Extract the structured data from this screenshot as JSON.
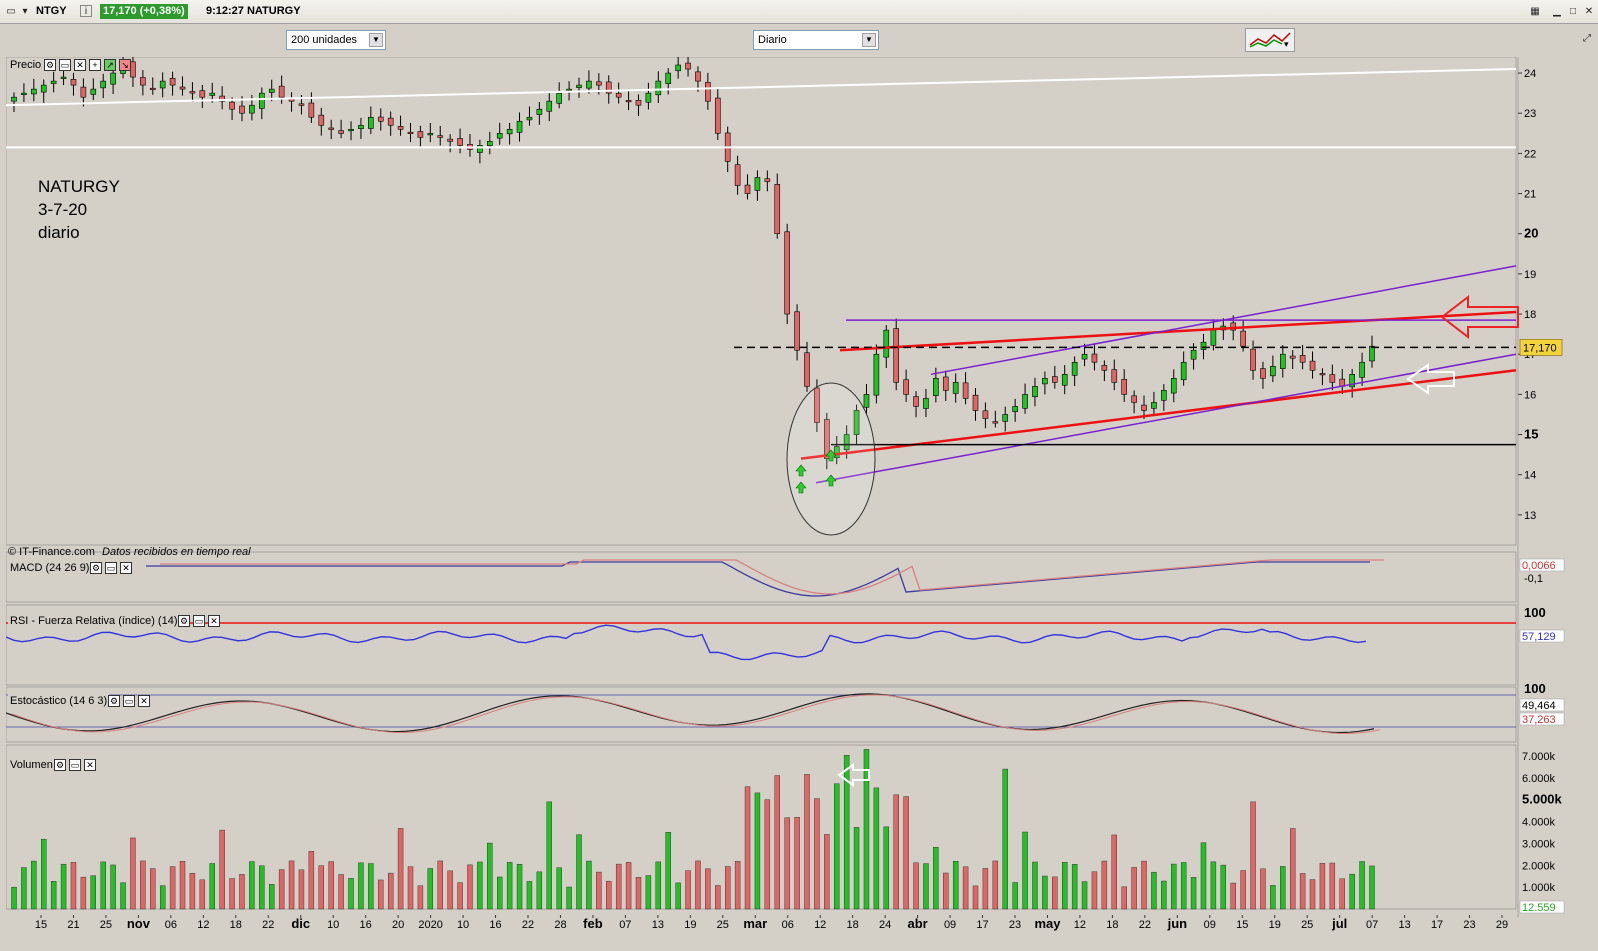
{
  "titlebar": {
    "ticker": "NTGY",
    "price_change": "17,170 (+0,38%)",
    "time_name": "9:12:27 NATURGY"
  },
  "toolbar": {
    "units_select": "200 unidades",
    "interval_select": "Diario"
  },
  "annotation": {
    "line1": "NATURGY",
    "line2": "3-7-20",
    "line3": "diario"
  },
  "copyright": "© IT-Finance.com",
  "realtime_note": "Datos recibidos en tiempo real",
  "panels": {
    "price_label": "Precio",
    "macd_label": "MACD (24 26 9)",
    "rsi_label": "RSI - Fuerza Relativa (índice) (14)",
    "stoch_label": "Estocástico (14 6 3)",
    "volume_label": "Volumen"
  },
  "colors": {
    "up": "#22c022",
    "down": "#e06666",
    "background": "#d4d0c8",
    "red_trend": "#ee1111",
    "purple_trend": "#7a1fd0",
    "rsi_line": "#3333dd"
  },
  "chart_data": [
    {
      "type": "candlestick",
      "title": "Precio",
      "y_ticks": [
        13,
        14,
        15,
        16,
        17,
        18,
        19,
        20,
        21,
        22,
        23,
        24
      ],
      "ylim": [
        12.25,
        24.4
      ],
      "last_price_label": "17,170",
      "x_labels": [
        "15",
        "21",
        "25",
        "nov",
        "06",
        "12",
        "18",
        "22",
        "dic",
        "10",
        "16",
        "20",
        "2020",
        "10",
        "16",
        "22",
        "28",
        "feb",
        "07",
        "13",
        "19",
        "25",
        "mar",
        "06",
        "12",
        "18",
        "24",
        "abr",
        "09",
        "17",
        "23",
        "may",
        "12",
        "18",
        "22",
        "jun",
        "09",
        "15",
        "19",
        "25",
        "jul",
        "07",
        "13",
        "17",
        "23",
        "29"
      ],
      "close_path": [
        23.4,
        23.5,
        23.6,
        23.7,
        23.8,
        23.9,
        23.7,
        23.4,
        23.6,
        23.8,
        24.0,
        24.2,
        23.9,
        23.7,
        23.6,
        23.8,
        23.7,
        23.6,
        23.5,
        23.4,
        23.5,
        23.3,
        23.1,
        23.0,
        23.2,
        23.5,
        23.6,
        23.4,
        23.3,
        23.2,
        22.9,
        22.7,
        22.6,
        22.5,
        22.6,
        22.7,
        22.9,
        22.8,
        22.7,
        22.6,
        22.5,
        22.4,
        22.5,
        22.4,
        22.3,
        22.2,
        22.1,
        22.2,
        22.3,
        22.5,
        22.6,
        22.8,
        22.9,
        23.1,
        23.3,
        23.5,
        23.6,
        23.7,
        23.8,
        23.7,
        23.5,
        23.4,
        23.3,
        23.2,
        23.5,
        23.8,
        24.0,
        24.2,
        24.1,
        23.8,
        23.3,
        22.5,
        21.8,
        21.2,
        21.0,
        21.4,
        21.3,
        20.0,
        18.0,
        17.1,
        16.2,
        15.3,
        14.4,
        14.7,
        15.0,
        15.6,
        16.0,
        17.0,
        17.6,
        16.3,
        16.0,
        15.7,
        15.9,
        16.4,
        16.1,
        16.3,
        15.9,
        15.6,
        15.4,
        15.3,
        15.5,
        15.7,
        16.0,
        16.2,
        16.4,
        16.3,
        16.5,
        16.8,
        17.0,
        16.8,
        16.6,
        16.3,
        16.0,
        15.8,
        15.6,
        15.8,
        16.1,
        16.4,
        16.8,
        17.1,
        17.3,
        17.6,
        17.7,
        17.6,
        17.2,
        16.6,
        16.4,
        16.7,
        17.0,
        16.9,
        16.8,
        16.6,
        16.5,
        16.3,
        16.2,
        16.5,
        16.8,
        17.2
      ],
      "trendlines": [
        {
          "name": "red upper",
          "from": [
            "mar 18",
            17.1
          ],
          "to": [
            "jul 29",
            18.05
          ],
          "color": "red"
        },
        {
          "name": "red lower",
          "from": [
            "mar 12",
            14.4
          ],
          "to": [
            "jul 29",
            16.6
          ],
          "color": "red"
        },
        {
          "name": "purple lower",
          "from": [
            "mar 16",
            13.8
          ],
          "to": [
            "jul 29",
            17.0
          ],
          "color": "purple"
        },
        {
          "name": "purple upper",
          "from": [
            "abr 01",
            16.5
          ],
          "to": [
            "jul 29",
            19.2
          ],
          "color": "purple"
        },
        {
          "name": "resistance",
          "value": 17.85,
          "color": "purple"
        },
        {
          "name": "support",
          "value": 14.75,
          "color": "black"
        },
        {
          "name": "old channel upper",
          "from": [
            "oct",
            23.2
          ],
          "to": [
            "jul 29",
            24.1
          ],
          "color": "white"
        },
        {
          "name": "old channel lower",
          "value": 22.15,
          "color": "white"
        },
        {
          "name": "current price",
          "value": 17.17,
          "style": "dashed"
        }
      ]
    },
    {
      "type": "line",
      "title": "MACD (24 26 9)",
      "y_ticks": [
        "-0,1"
      ],
      "last_value": "0,0066"
    },
    {
      "type": "line",
      "title": "RSI - Fuerza Relativa (índice) (14)",
      "y_ticks": [
        "100"
      ],
      "last_value": "57,129"
    },
    {
      "type": "line",
      "title": "Estocástico (14 6 3)",
      "y_ticks": [
        "100"
      ],
      "series": [
        {
          "values_last": "49,464"
        },
        {
          "values_last": "37,263"
        }
      ]
    },
    {
      "type": "bar",
      "title": "Volumen",
      "y_ticks": [
        "7.000k",
        "6.000k",
        "5.000k",
        "4.000k",
        "3.000k",
        "2.000k",
        "1.000k"
      ],
      "ylim": [
        0,
        7.5
      ],
      "last_value": "12.559"
    }
  ]
}
